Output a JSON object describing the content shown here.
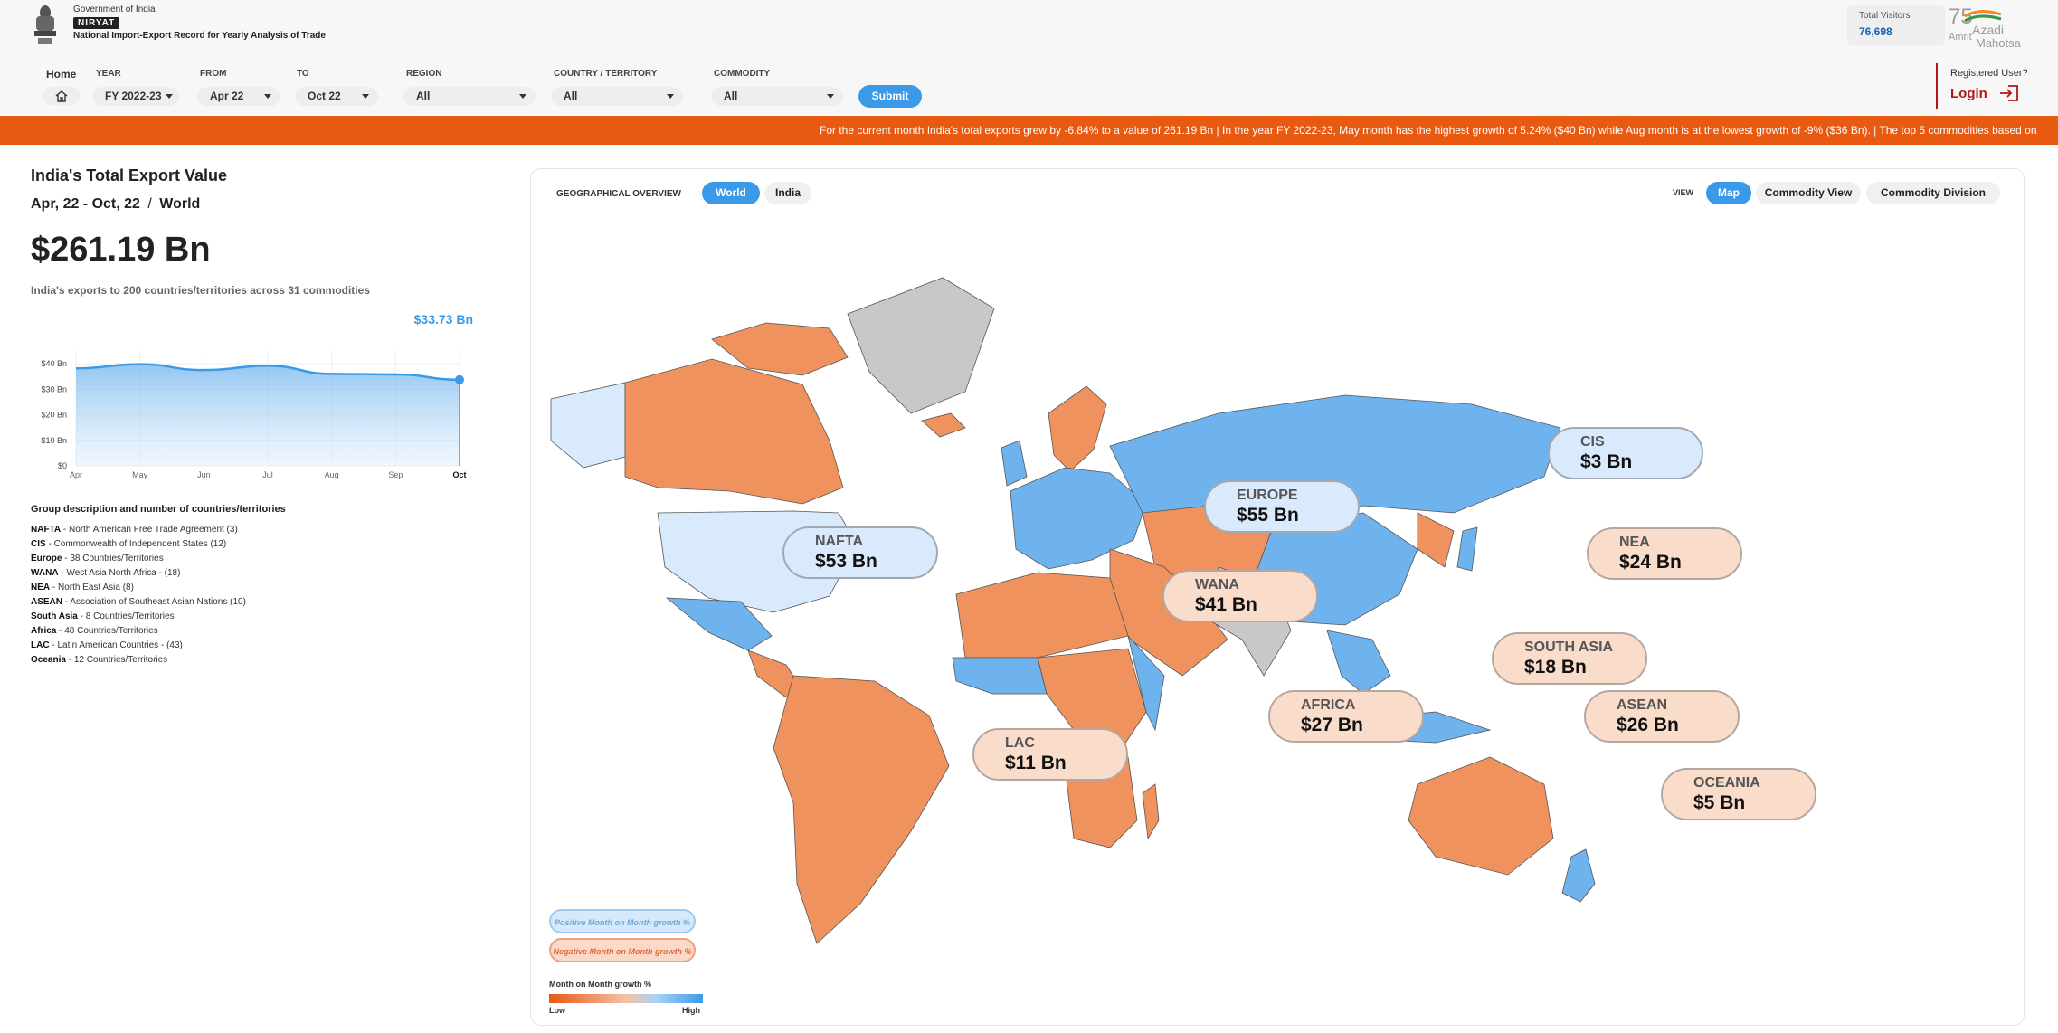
{
  "header": {
    "gov": "Government of India",
    "badge": "NIRYAT",
    "fullname": "National Import-Export Record for Yearly Analysis of Trade",
    "visitors_label": "Total Visitors",
    "visitors_count": "76,698",
    "registered_label": "Registered User?",
    "login_label": "Login"
  },
  "filters": {
    "home": "Home",
    "year_label": "YEAR",
    "year_value": "FY 2022-23",
    "from_label": "FROM",
    "from_value": "Apr 22",
    "to_label": "TO",
    "to_value": "Oct 22",
    "region_label": "REGION",
    "region_value": "All",
    "country_label": "COUNTRY / TERRITORY",
    "country_value": "All",
    "commodity_label": "COMMODITY",
    "commodity_value": "All",
    "submit": "Submit"
  },
  "ticker": "For the current month India's total exports grew by -6.84% to a value of 261.19 Bn    |    In the year FY 2022-23, May month has the highest growth of 5.24% ($40 Bn) while Aug month is at the lowest growth of -9% ($36 Bn).    |    The top 5 commodities based on",
  "summary": {
    "title": "India's Total Export Value",
    "period": "Apr, 22 - Oct, 22",
    "sep": "/",
    "scope": "World",
    "value": "$261.19 Bn",
    "desc": "India's exports to 200 countries/territories across 31 commodities"
  },
  "chart_data": {
    "type": "area",
    "categories": [
      "Apr",
      "May",
      "Jun",
      "Jul",
      "Aug",
      "Sep",
      "Oct"
    ],
    "values": [
      38.2,
      39.8,
      37.5,
      39.2,
      36.0,
      35.8,
      33.73
    ],
    "highlight_label": "$33.73 Bn",
    "y_ticks": [
      "$0",
      "$10 Bn",
      "$20 Bn",
      "$30 Bn",
      "$40 Bn"
    ],
    "ylim": [
      0,
      45
    ],
    "color": "#3a9ae8"
  },
  "groups": {
    "title": "Group description and number of countries/territories",
    "items": [
      {
        "code": "NAFTA",
        "desc": "North American Free Trade Agreement (3)"
      },
      {
        "code": "CIS",
        "desc": "Commonwealth of Independent States (12)"
      },
      {
        "code": "Europe",
        "desc": "38 Countries/Territories"
      },
      {
        "code": "WANA",
        "desc": "West Asia North Africa - (18)"
      },
      {
        "code": "NEA",
        "desc": "North East Asia (8)"
      },
      {
        "code": "ASEAN",
        "desc": "Association of Southeast Asian Nations (10)"
      },
      {
        "code": "South Asia",
        "desc": "8 Countries/Territories"
      },
      {
        "code": "Africa",
        "desc": "48 Countries/Territories"
      },
      {
        "code": "LAC",
        "desc": "Latin American Countries - (43)"
      },
      {
        "code": "Oceania",
        "desc": "12 Countries/Territories"
      }
    ]
  },
  "map": {
    "geo_label": "GEOGRAPHICAL OVERVIEW",
    "scope_tabs": [
      "World",
      "India"
    ],
    "view_label": "VIEW",
    "view_tabs": [
      "Map",
      "Commodity View",
      "Commodity Division"
    ],
    "legend_positive": "Positive Month on Month growth %",
    "legend_negative": "Negative Month on Month growth %",
    "gradient_title": "Month on Month growth %",
    "gradient_low": "Low",
    "gradient_high": "High",
    "colors": {
      "positive": "#6fb3ee",
      "negative": "#f0925e",
      "neutral": "#c8c8c8"
    },
    "regions": [
      {
        "name": "NAFTA",
        "value": "$53 Bn",
        "trend": "positive"
      },
      {
        "name": "EUROPE",
        "value": "$55 Bn",
        "trend": "positive"
      },
      {
        "name": "CIS",
        "value": "$3 Bn",
        "trend": "positive"
      },
      {
        "name": "WANA",
        "value": "$41 Bn",
        "trend": "negative"
      },
      {
        "name": "NEA",
        "value": "$24 Bn",
        "trend": "negative"
      },
      {
        "name": "SOUTH ASIA",
        "value": "$18 Bn",
        "trend": "negative"
      },
      {
        "name": "AFRICA",
        "value": "$27 Bn",
        "trend": "negative"
      },
      {
        "name": "ASEAN",
        "value": "$26 Bn",
        "trend": "negative"
      },
      {
        "name": "LAC",
        "value": "$11 Bn",
        "trend": "negative"
      },
      {
        "name": "OCEANIA",
        "value": "$5 Bn",
        "trend": "negative"
      }
    ]
  }
}
